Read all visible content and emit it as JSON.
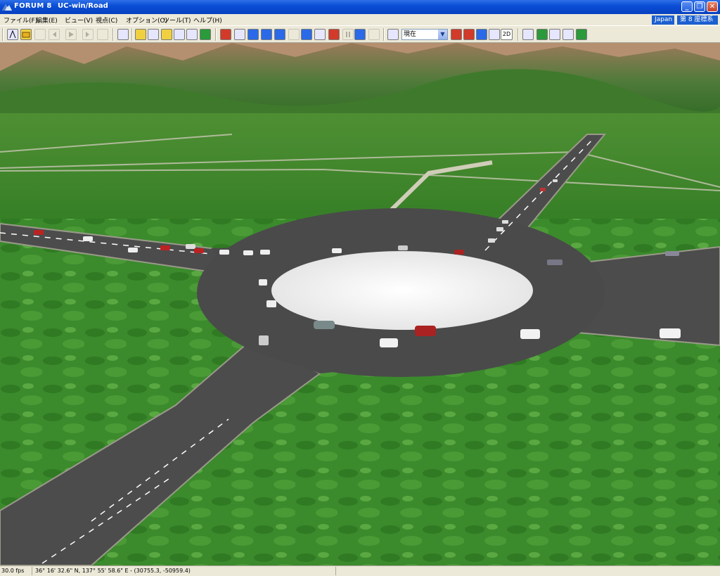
{
  "window": {
    "title": "FORUM 8",
    "subtitle": "UC-win/Road"
  },
  "menu": {
    "items": [
      "ファイル(F)",
      "編集(E)",
      "ビュー(V)",
      "視点(C)",
      "オプション(O)",
      "ツール(T)",
      "ヘルプ(H)"
    ],
    "region_label": "Japan",
    "coord_system_label": "第 8 座標系"
  },
  "toolbar": {
    "view_select_value": "現在",
    "view_2d_label": "2D"
  },
  "status": {
    "fps": "30.0 fps",
    "coordinates": "36°  16' 32.6\" N, 137°  55' 58.6\" E  -  (30755.3, -50959.4)"
  },
  "colors": {
    "titlebar": "#0a4fd6",
    "road": "#4a4a4a",
    "grass": "#3d8a2c",
    "roundabout_island": "#f2f2f2"
  }
}
